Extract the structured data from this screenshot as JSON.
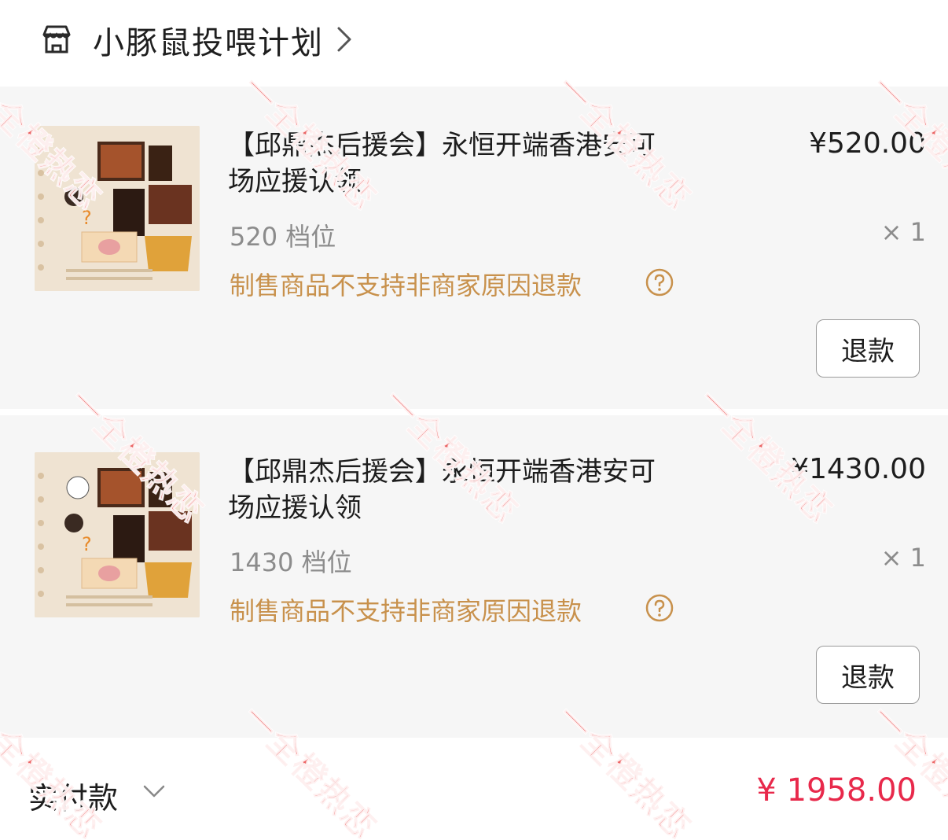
{
  "shop": {
    "name": "小豚鼠投喂计划",
    "icon": "shop-icon"
  },
  "items": [
    {
      "title": "【邱鼎杰后援会】永恒开端香港安可场应援认领",
      "price": "¥520.00",
      "variant": "520 档位",
      "quantity": "× 1",
      "refund_policy": "制售商品不支持非商家原因退款",
      "refund_button": "退款"
    },
    {
      "title": "【邱鼎杰后援会】永恒开端香港安可场应援认领",
      "price": "¥1430.00",
      "variant": "1430 档位",
      "quantity": "× 1",
      "refund_policy": "制售商品不支持非商家原因退款",
      "refund_button": "退款"
    }
  ],
  "total": {
    "label": "实付款",
    "amount": "¥ 1958.00"
  },
  "watermark": "一全橙热恋",
  "colors": {
    "accent_price": "#e8294b",
    "policy_text": "#c8914c",
    "watermark": "#e83c3c"
  }
}
